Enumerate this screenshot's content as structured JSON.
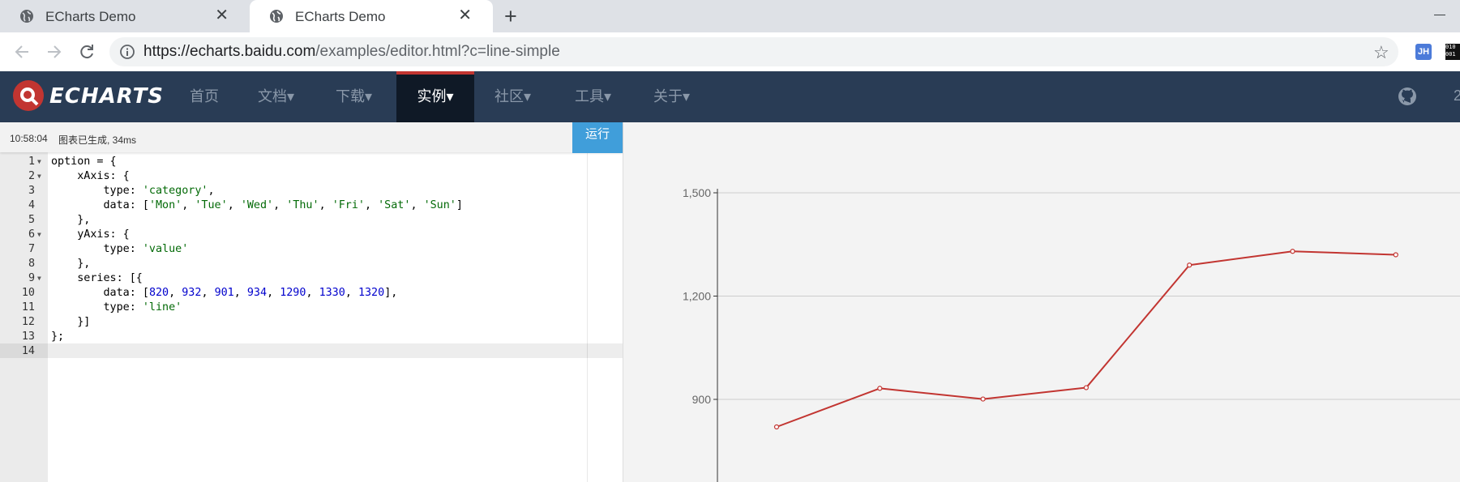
{
  "browser": {
    "tabs": [
      {
        "title": "ECharts Demo",
        "close": "✕"
      },
      {
        "title": "ECharts Demo",
        "close": "✕"
      }
    ],
    "new_tab": "+",
    "url_host": "https://echarts.baidu.com",
    "url_path": "/examples/editor.html?c=line-simple",
    "extension_jh": "JH",
    "extension_bin": "010 001"
  },
  "nav": {
    "logo_text": "ECHARTS",
    "items": [
      "首页",
      "文档▾",
      "下载▾",
      "实例▾",
      "社区▾",
      "工具▾",
      "关于▾"
    ],
    "edge_text": "2"
  },
  "editor": {
    "status_time": "10:58:04",
    "status_msg": "图表已生成, 34ms",
    "run_label": "运行",
    "line_numbers": [
      "1",
      "2",
      "3",
      "4",
      "5",
      "6",
      "7",
      "8",
      "9",
      "10",
      "11",
      "12",
      "13",
      "14"
    ]
  },
  "chart_data": {
    "type": "line",
    "categories": [
      "Mon",
      "Tue",
      "Wed",
      "Thu",
      "Fri",
      "Sat",
      "Sun"
    ],
    "values": [
      820,
      932,
      901,
      934,
      1290,
      1330,
      1320
    ],
    "y_ticks": [
      "900",
      "1,200",
      "1,500"
    ],
    "y_tick_values": [
      900,
      1200,
      1500
    ],
    "line_color": "#c23531",
    "grid": true
  }
}
